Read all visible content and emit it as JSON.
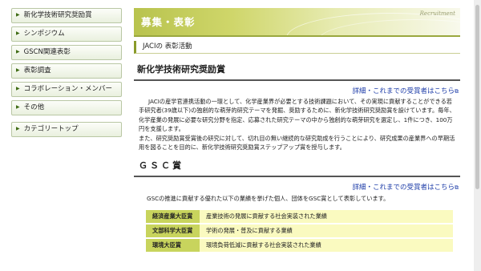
{
  "sidebar": {
    "items": [
      {
        "label": "新化学技術研究奨励賞"
      },
      {
        "label": "シンポジウム"
      },
      {
        "label": "GSCN関連表彰"
      },
      {
        "label": "表彰調査"
      },
      {
        "label": "コラボレーション・メンバー"
      },
      {
        "label": "その他"
      }
    ],
    "category_top": "カテゴリートップ"
  },
  "banner": {
    "title": "募集・表彰",
    "english": "Recruitment"
  },
  "subheader": "JACIの 表彰活動",
  "section1": {
    "title": "新化学技術研究奨励賞",
    "link": "詳細・これまでの受賞者はこちら",
    "para1": "JACIの産学官連携活動の一環として、化学産業界が必要とする技術課題において、その実現に貢献することができる若手研究者(39歳以下)の独創的な萌芽的研究テーマを発掘、奨励するために、新化学技術研究奨励賞を設けています。毎年、化学産業の発展に必要な研究分野を指定、応募された研究テーマの中から独創的な萌芽研究を選定し、1件につき、100万円を支援します。",
    "para2": "また、研究奨励賞受賞後の研究に対して、切れ目の無い継続的な研究助成を行うことにより、研究成果の産業界への早期活用を図ることを目的に、新化学技術研究奨励賞ステップアップ賞を授与します。"
  },
  "section2": {
    "title": "ＧＳＣ賞",
    "link": "詳細・これまでの受賞者はこちら",
    "intro": "GSCの推進に貢献する優れた以下の業績を挙げた個人、団体をGSC賞として表彰しています。",
    "awards": [
      {
        "name": "経済産業大臣賞",
        "desc": "産業技術の発展に貢献する社会実装された業績"
      },
      {
        "name": "文部科学大臣賞",
        "desc": "学術の発展・普及に貢献する業績"
      },
      {
        "name": "環境大臣賞",
        "desc": "環境負荷低減に貢献する社会実装された業績"
      }
    ]
  },
  "icons": {
    "menu_arrow": "arrow-right-icon",
    "external": "external-link-icon"
  },
  "colors": {
    "accent": "#9aa83e",
    "award_name_bg": "#c8d45d",
    "award_desc_bg": "#fafac0",
    "link": "#1d3ca8"
  }
}
